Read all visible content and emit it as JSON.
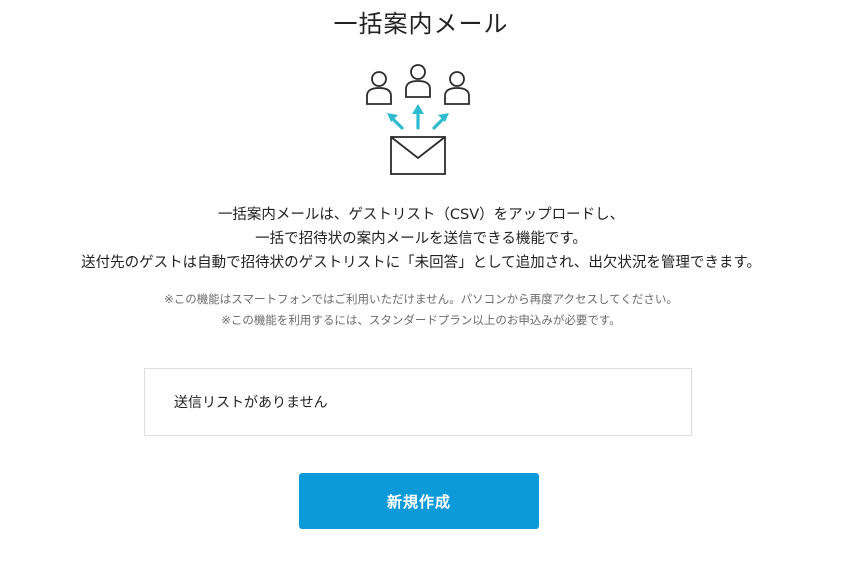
{
  "page": {
    "title": "一括案内メール"
  },
  "illustration": {
    "icons": [
      "person-icon",
      "person-icon",
      "person-icon",
      "arrow-up-left-icon",
      "arrow-up-icon",
      "arrow-up-right-icon",
      "envelope-icon"
    ],
    "arrow_color": "#2fbcd0",
    "line_color": "#2b2b2b"
  },
  "description": {
    "line1": "一括案内メールは、ゲストリスト（CSV）をアップロードし、",
    "line2": "一括で招待状の案内メールを送信できる機能です。",
    "line3": "送付先のゲストは自動で招待状のゲストリストに「未回答」として追加され、出欠状況を管理できます。"
  },
  "notes": {
    "note1": "※この機能はスマートフォンではご利用いただけません。パソコンから再度アクセスしてください。",
    "note2": "※この機能を利用するには、スタンダードプラン以上のお申込みが必要です。"
  },
  "send_list": {
    "empty_message": "送信リストがありません"
  },
  "actions": {
    "create_label": "新規作成",
    "button_color": "#0c9ad9"
  }
}
